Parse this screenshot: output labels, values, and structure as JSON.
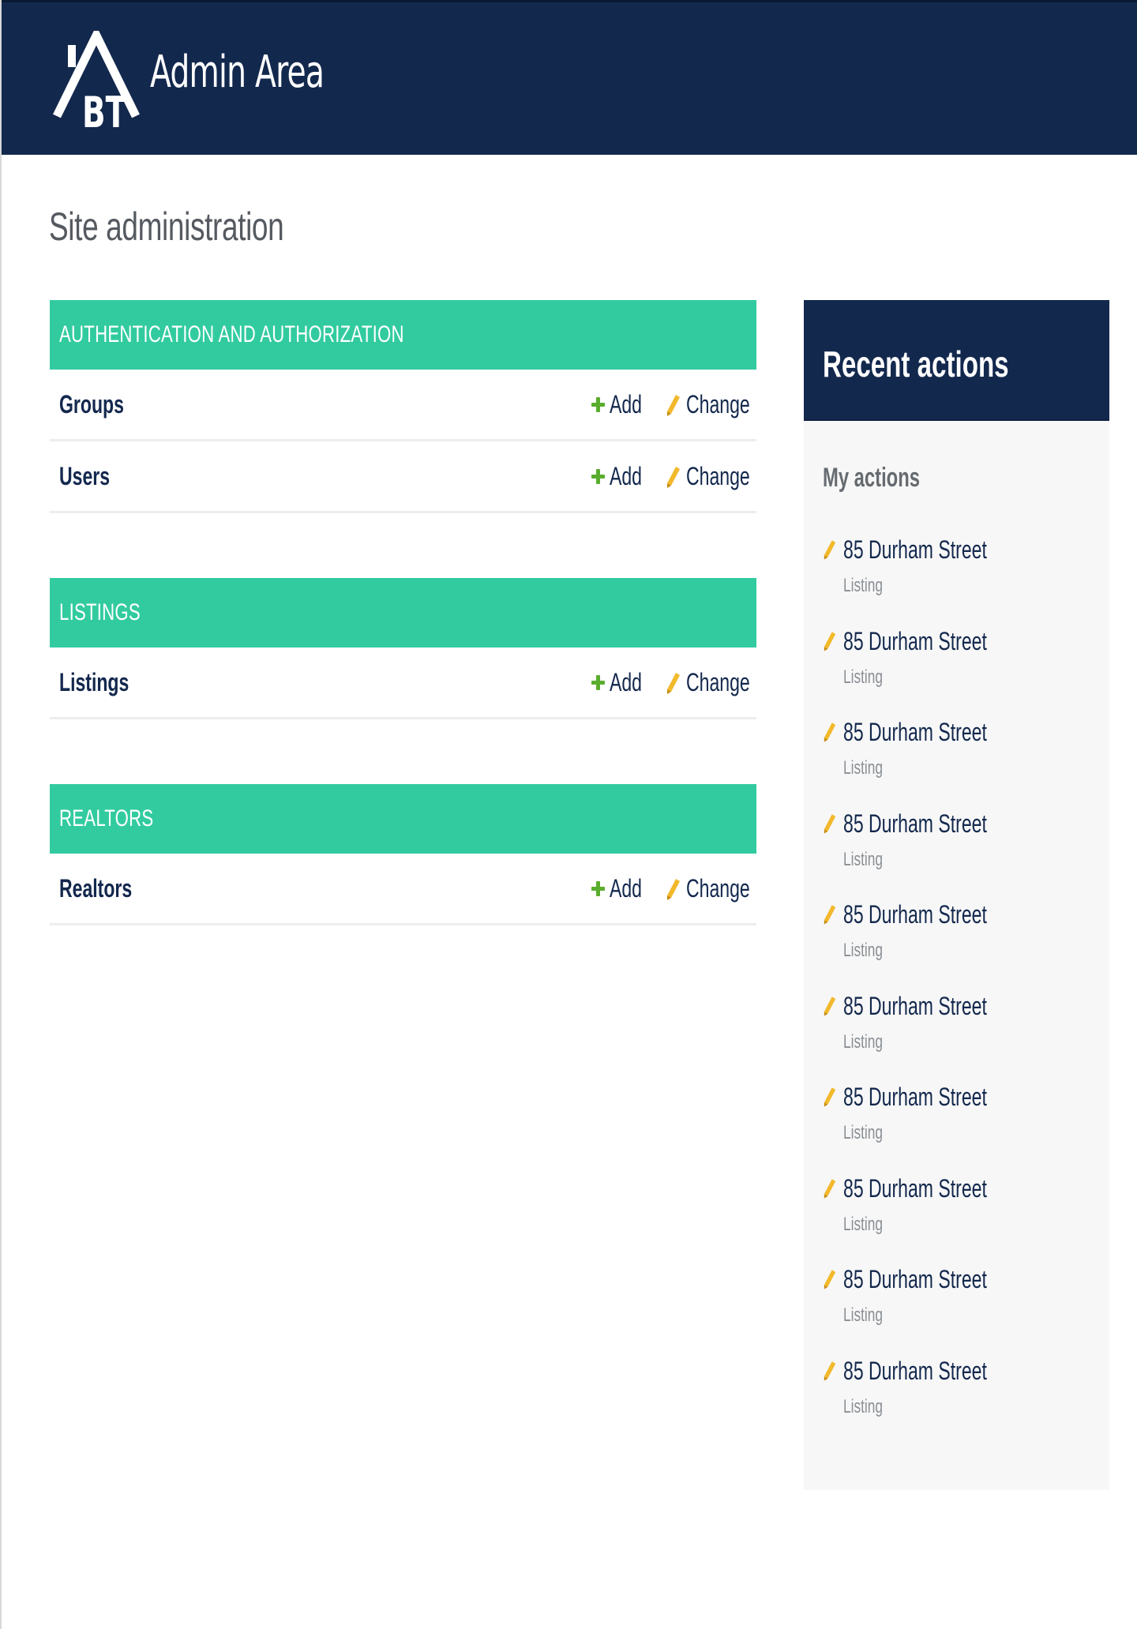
{
  "header": {
    "brand_title": "Admin Area",
    "logo_text": "BT",
    "background_color": "#13284d"
  },
  "page_title": "Site administration",
  "accent_color": "#32cba0",
  "modules": [
    {
      "caption": "AUTHENTICATION AND AUTHORIZATION",
      "models": [
        {
          "name": "Groups",
          "add_label": "Add",
          "change_label": "Change"
        },
        {
          "name": "Users",
          "add_label": "Add",
          "change_label": "Change"
        }
      ]
    },
    {
      "caption": "LISTINGS",
      "models": [
        {
          "name": "Listings",
          "add_label": "Add",
          "change_label": "Change"
        }
      ]
    },
    {
      "caption": "REALTORS",
      "models": [
        {
          "name": "Realtors",
          "add_label": "Add",
          "change_label": "Change"
        }
      ]
    }
  ],
  "recent_actions": {
    "title": "Recent actions",
    "subtitle": "My actions",
    "items": [
      {
        "object": "85 Durham Street",
        "type": "Listing",
        "icon": "pencil-icon"
      },
      {
        "object": "85 Durham Street",
        "type": "Listing",
        "icon": "pencil-icon"
      },
      {
        "object": "85 Durham Street",
        "type": "Listing",
        "icon": "pencil-icon"
      },
      {
        "object": "85 Durham Street",
        "type": "Listing",
        "icon": "pencil-icon"
      },
      {
        "object": "85 Durham Street",
        "type": "Listing",
        "icon": "pencil-icon"
      },
      {
        "object": "85 Durham Street",
        "type": "Listing",
        "icon": "pencil-icon"
      },
      {
        "object": "85 Durham Street",
        "type": "Listing",
        "icon": "pencil-icon"
      },
      {
        "object": "85 Durham Street",
        "type": "Listing",
        "icon": "pencil-icon"
      },
      {
        "object": "85 Durham Street",
        "type": "Listing",
        "icon": "pencil-icon"
      },
      {
        "object": "85 Durham Street",
        "type": "Listing",
        "icon": "pencil-icon"
      }
    ]
  }
}
